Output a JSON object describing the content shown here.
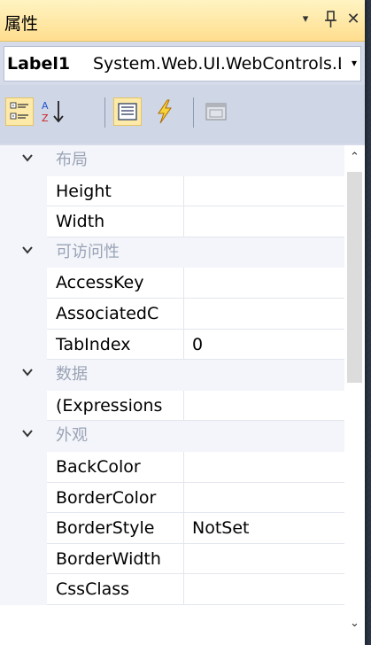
{
  "title_bar": {
    "title": "属性",
    "dropdown_glyph": "▾",
    "pin_glyph": "₽",
    "close_glyph": "✕"
  },
  "object_selector": {
    "name": "Label1",
    "type": "System.Web.UI.WebControls.Label",
    "arrow_glyph": "▾"
  },
  "toolbar": {
    "buttons": [
      {
        "icon": "categorized-icon",
        "active": true
      },
      {
        "icon": "alphabetical-icon",
        "active": false
      },
      {
        "icon": "properties-icon",
        "active": true
      },
      {
        "icon": "events-icon",
        "active": false
      },
      {
        "icon": "property-pages-icon",
        "active": false
      }
    ]
  },
  "grid": {
    "chevron_glyph": "✔",
    "rows": [
      {
        "kind": "category",
        "name": "布局"
      },
      {
        "kind": "property",
        "name": "Height",
        "value": ""
      },
      {
        "kind": "property",
        "name": "Width",
        "value": ""
      },
      {
        "kind": "category",
        "name": "可访问性"
      },
      {
        "kind": "property",
        "name": "AccessKey",
        "value": ""
      },
      {
        "kind": "property",
        "name": "AssociatedC",
        "value": ""
      },
      {
        "kind": "property",
        "name": "TabIndex",
        "value": "0"
      },
      {
        "kind": "category",
        "name": "数据"
      },
      {
        "kind": "property",
        "name": "(Expressions",
        "value": ""
      },
      {
        "kind": "category",
        "name": "外观"
      },
      {
        "kind": "property",
        "name": "BackColor",
        "value": ""
      },
      {
        "kind": "property",
        "name": "BorderColor",
        "value": ""
      },
      {
        "kind": "property",
        "name": "BorderStyle",
        "value": "NotSet"
      },
      {
        "kind": "property",
        "name": "BorderWidth",
        "value": ""
      },
      {
        "kind": "property",
        "name": "CssClass",
        "value": ""
      }
    ]
  },
  "scrollbar": {
    "up_glyph": "⌃",
    "down_glyph": "⌄"
  },
  "colors": {
    "title_bar_bg": "#ffe8a6",
    "category_text": "#9aa3b5",
    "grid_bg": "#ffffff",
    "gutter_bg": "#f3f5fa"
  }
}
